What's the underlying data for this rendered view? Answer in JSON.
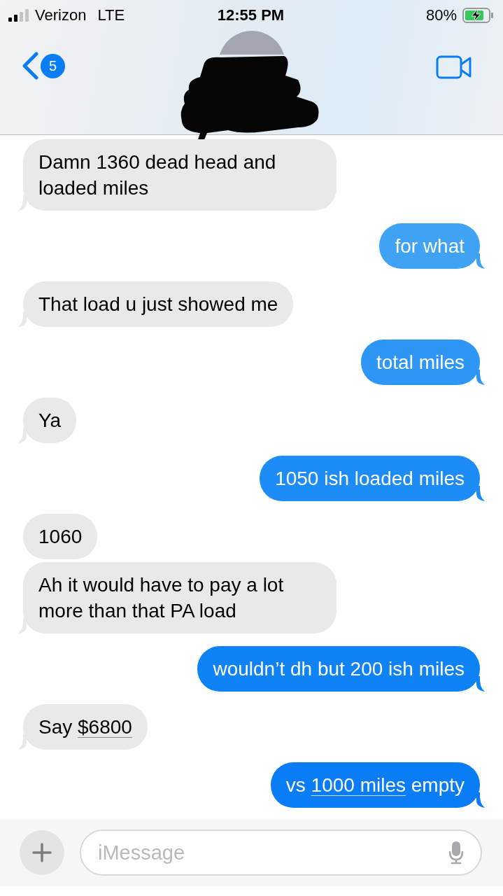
{
  "status_bar": {
    "carrier": "Verizon",
    "network": "LTE",
    "time": "12:55 PM",
    "battery": "80%",
    "charging": true
  },
  "header": {
    "back_badge": "5"
  },
  "messages": [
    {
      "kind": "received",
      "tail": true,
      "color": "#e9e9eb",
      "segments": [
        {
          "text": "Damn 1360 dead head and loaded miles",
          "link": false
        }
      ]
    },
    {
      "kind": "sent",
      "tail": true,
      "color": "#3fa2f5",
      "segments": [
        {
          "text": "for what",
          "link": false
        }
      ]
    },
    {
      "kind": "received",
      "tail": true,
      "color": "#e9e9eb",
      "segments": [
        {
          "text": "That load u just showed me",
          "link": false
        }
      ]
    },
    {
      "kind": "sent",
      "tail": true,
      "color": "#2e97f6",
      "segments": [
        {
          "text": "total miles",
          "link": false
        }
      ]
    },
    {
      "kind": "received",
      "tail": true,
      "color": "#e9e9eb",
      "segments": [
        {
          "text": "Ya",
          "link": false
        }
      ]
    },
    {
      "kind": "sent",
      "tail": true,
      "color": "#1e8cf6",
      "segments": [
        {
          "text": "1050 ish loaded miles",
          "link": false
        }
      ]
    },
    {
      "kind": "received",
      "tail": false,
      "color": "#e9e9eb",
      "segments": [
        {
          "text": "1060",
          "link": false
        }
      ]
    },
    {
      "kind": "received",
      "tail": true,
      "color": "#e9e9eb",
      "segments": [
        {
          "text": "Ah it would have to pay a lot more than that PA load",
          "link": false
        }
      ]
    },
    {
      "kind": "sent",
      "tail": true,
      "color": "#0f82f6",
      "segments": [
        {
          "text": "wouldn’t dh but 200 ish miles",
          "link": false
        }
      ]
    },
    {
      "kind": "received",
      "tail": true,
      "color": "#e9e9eb",
      "segments": [
        {
          "text": "Say ",
          "link": false
        },
        {
          "text": "$6800",
          "link": true
        }
      ]
    },
    {
      "kind": "sent",
      "tail": true,
      "color": "#0a7cf5",
      "segments": [
        {
          "text": "vs ",
          "link": false
        },
        {
          "text": "1000 miles",
          "link": true
        },
        {
          "text": " empty",
          "link": false
        }
      ]
    }
  ],
  "composer": {
    "placeholder": "iMessage"
  }
}
